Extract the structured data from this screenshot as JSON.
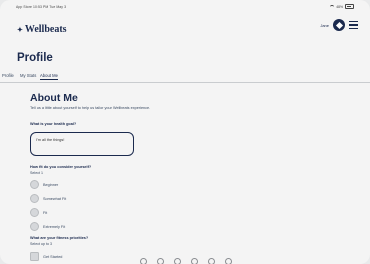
{
  "statusbar": {
    "time": "App Store 10:53 PM Tue May 3",
    "battery": "48%"
  },
  "header": {
    "logo_text": "Wellbeats",
    "logo_star": "✦",
    "user_name": "Jane"
  },
  "page": {
    "title": "Profile"
  },
  "tabs": [
    {
      "label": "Profile"
    },
    {
      "label": "My Stats"
    },
    {
      "label": "About Me"
    }
  ],
  "about": {
    "title": "About Me",
    "subtitle": "Tell us a little about yourself to help us tailor your Wellbeats experience.",
    "health_goal": {
      "label": "What is your health goal?",
      "value": "I'm all the things!"
    },
    "fitness_level": {
      "label": "How fit do you consider yourself?",
      "hint": "Select 1",
      "options": [
        "Beginner",
        "Somewhat Fit",
        "Fit",
        "Extremely Fit"
      ]
    },
    "fitness_priorities": {
      "label": "What are your fitness priorities?",
      "hint": "Select up to 3",
      "options": [
        "Get Started"
      ]
    }
  },
  "colors": {
    "navy": "#1b2a4e",
    "background": "#f4f4f4",
    "control": "#d5d7da"
  }
}
